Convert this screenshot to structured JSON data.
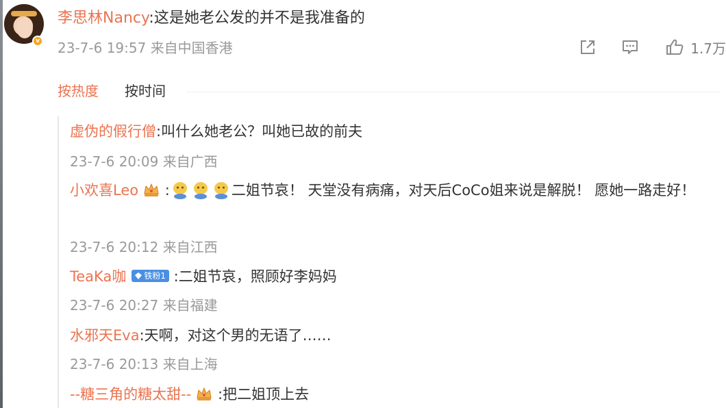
{
  "post": {
    "author_name": "李思林Nancy",
    "separator": ":",
    "text": "这是她老公发的并不是我准备的",
    "timestamp": "23-7-6 19:57",
    "location": "来自中国香港",
    "like_count": "1.7万",
    "verified_badge": "v",
    "icons": [
      "share-icon",
      "comment-icon",
      "like-icon"
    ]
  },
  "sort_tabs": [
    {
      "label": "按热度",
      "active": true
    },
    {
      "label": "按时间",
      "active": false
    }
  ],
  "replies": [
    {
      "name": "虚伪的假行僧",
      "separator": ":",
      "text": "叫什么她老公？叫她已故的前夫",
      "timestamp": "23-7-6 20:09",
      "location": "来自广西"
    },
    {
      "name": "小欢喜Leo",
      "separator": " :",
      "text": "二姐节哀！  天堂没有病痛，对天后CoCo姐来说是解脱！ 愿她一路走好！",
      "timestamp": "23-7-6 20:12",
      "location": "来自江西",
      "badge_icon": "crown-icon",
      "emoji_icon": "doge-emoji-icon",
      "emoji_count": 3
    },
    {
      "name": "TeaKa咖",
      "separator": " :",
      "text": "二姐节哀，照顾好李妈妈",
      "timestamp": "23-7-6 20:27",
      "location": "来自福建",
      "badge": "铁粉1",
      "badge_icon": "diamond-icon"
    },
    {
      "name": "水邪天Eva",
      "separator": ":",
      "text": "天啊，对这个男的无语了……",
      "timestamp": "23-7-6 20:13",
      "location": "来自上海"
    },
    {
      "name": "--糖三角的糖太甜--",
      "separator": " :",
      "text": "把二姐顶上去",
      "badge_icon": "crown-icon"
    }
  ],
  "colors": {
    "name_orange": "#eb7350",
    "meta_gray": "#999999",
    "text_dark": "#333333",
    "fan_badge_blue": "#4a90e2",
    "verified_gold": "#f5a623"
  }
}
